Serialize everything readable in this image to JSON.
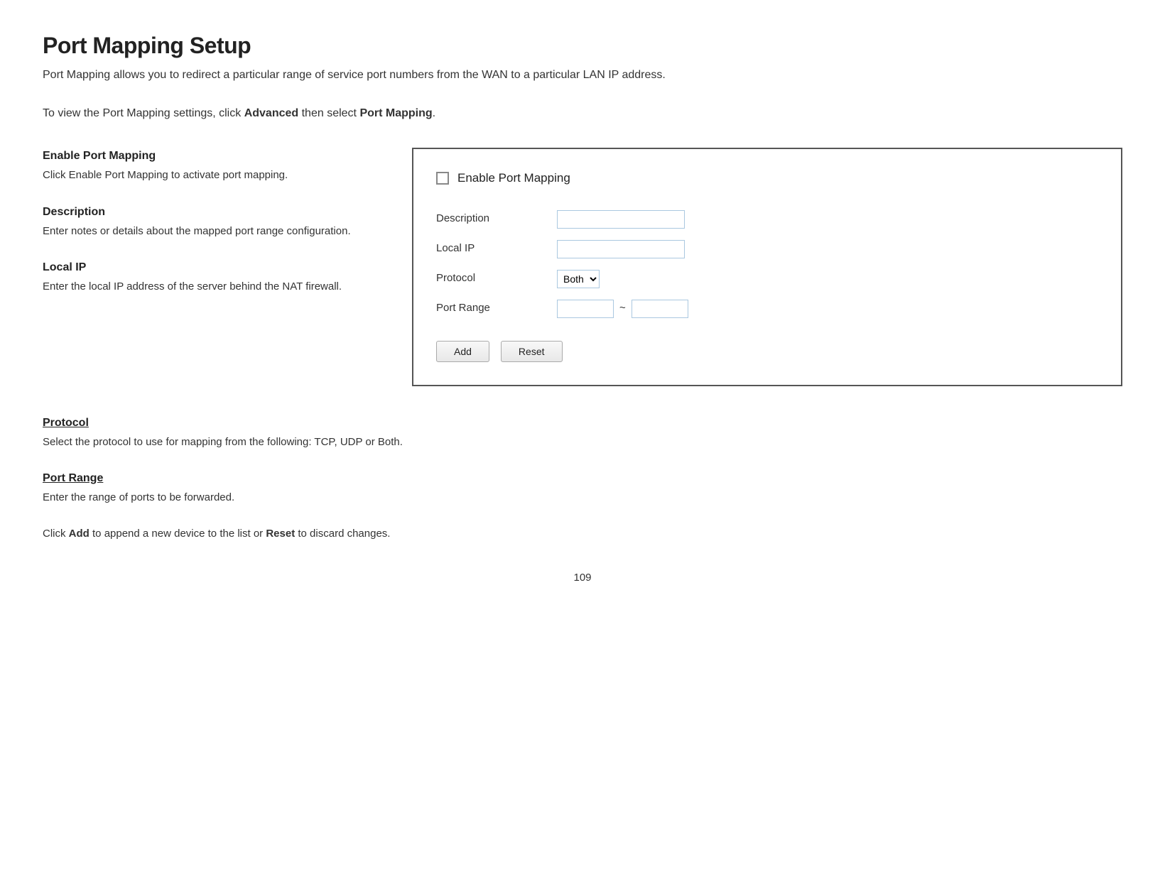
{
  "page": {
    "title": "Port Mapping Setup",
    "subtitle": "Port Mapping allows you to redirect a particular range of service port numbers from the WAN to a particular LAN IP address.",
    "intro": "To view the Port Mapping settings, click",
    "intro_bold1": "Advanced",
    "intro_mid": "then select",
    "intro_bold2": "Port Mapping",
    "intro_end": ".",
    "page_number": "109"
  },
  "left_panel": {
    "sections": [
      {
        "title": "Enable Port Mapping",
        "desc": "Click Enable Port Mapping to activate port mapping."
      },
      {
        "title": "Description",
        "desc": "Enter notes or details about the mapped port range configuration."
      },
      {
        "title": "Local IP",
        "desc": "Enter the local IP address of the server behind the NAT firewall."
      }
    ]
  },
  "form": {
    "enable_label": "Enable Port Mapping",
    "fields": [
      {
        "label": "Description",
        "type": "text",
        "name": "description"
      },
      {
        "label": "Local IP",
        "type": "text",
        "name": "local-ip"
      },
      {
        "label": "Protocol",
        "type": "select",
        "name": "protocol"
      },
      {
        "label": "Port Range",
        "type": "port-range",
        "name": "port-range"
      }
    ],
    "protocol_options": [
      "Both",
      "TCP",
      "UDP"
    ],
    "protocol_default": "Both",
    "add_button": "Add",
    "reset_button": "Reset"
  },
  "bottom_sections": [
    {
      "title": "Protocol",
      "text": "Select the protocol to use for mapping from the following: TCP, UDP or Both."
    },
    {
      "title": "Port Range",
      "text": "Enter the range of ports to be forwarded."
    },
    {
      "title_plain": "Click",
      "bold1": "Add",
      "mid": "to append a new device to the list or",
      "bold2": "Reset",
      "end": "to discard changes."
    }
  ]
}
